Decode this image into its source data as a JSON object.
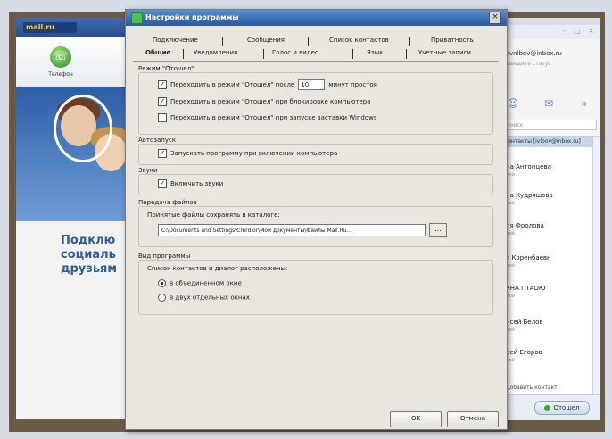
{
  "agent": {
    "logo": "mail.ru",
    "toolbar_phone": "Телефон",
    "promo_lines": [
      "Подклю",
      "социаль",
      "друзьям"
    ]
  },
  "contacts": {
    "window_buttons": "– □ ×",
    "email": "ivnlbov@inbox.ru",
    "status_placeholder": "введите статус",
    "search_placeholder": "поиск",
    "group_header": "Контакты [ivlbov@inbox.ru]",
    "items": [
      {
        "name": "на Антонцева",
        "sub": "мой"
      },
      {
        "name": "на Кудряшова",
        "sub": "мой"
      },
      {
        "name": "ля Фролова",
        "sub": "мой"
      },
      {
        "name": "я Коренбаевн",
        "sub": "мой"
      },
      {
        "name": "ХНА ПТАОЮ",
        "sub": "мой"
      },
      {
        "name": "нсей Белов",
        "sub": "мой"
      },
      {
        "name": "рей Егоров",
        "sub": "мой"
      }
    ],
    "add_contact": "Добавить контакт",
    "status_button": "Отошел"
  },
  "dialog": {
    "title": "Настройки программы",
    "close": "×",
    "tabs_row1": [
      "Подключение",
      "Сообщения",
      "Список контактов",
      "Приватность"
    ],
    "tabs_row2": [
      "Общие",
      "Уведомления",
      "Голос и видео",
      "Язык",
      "Учетные записи"
    ],
    "away_group": {
      "label": "Режим \"Отошел\"",
      "opt1_pre": "Переходить в режим \"Отошел\" после",
      "opt1_value": "10",
      "opt1_post": "минут простоя",
      "opt2": "Переходить в режим \"Отошел\" при блокировке компьютера",
      "opt3": "Переходить в режим \"Отошел\" при запуске заставки Windows"
    },
    "autostart_group": {
      "label": "Автозапуск",
      "opt": "Запускать программу при включении компьютера"
    },
    "sound_group": {
      "label": "Звуки",
      "opt": "Включить звуки"
    },
    "files_group": {
      "label": "Передача файлов",
      "caption": "Принятые файлы сохранять в каталоге:",
      "path": "C:\\Documents and Settings\\Cmrdlor\\Мои документы\\Файлы Mail.Ru...",
      "browse": "..."
    },
    "view_group": {
      "label": "Вид программы",
      "caption": "Список контактов и диалог расположены:",
      "radio1": "в объединенном окне",
      "radio2": "в двух отдельных окнах"
    },
    "ok": "OK",
    "cancel": "Отмена"
  }
}
